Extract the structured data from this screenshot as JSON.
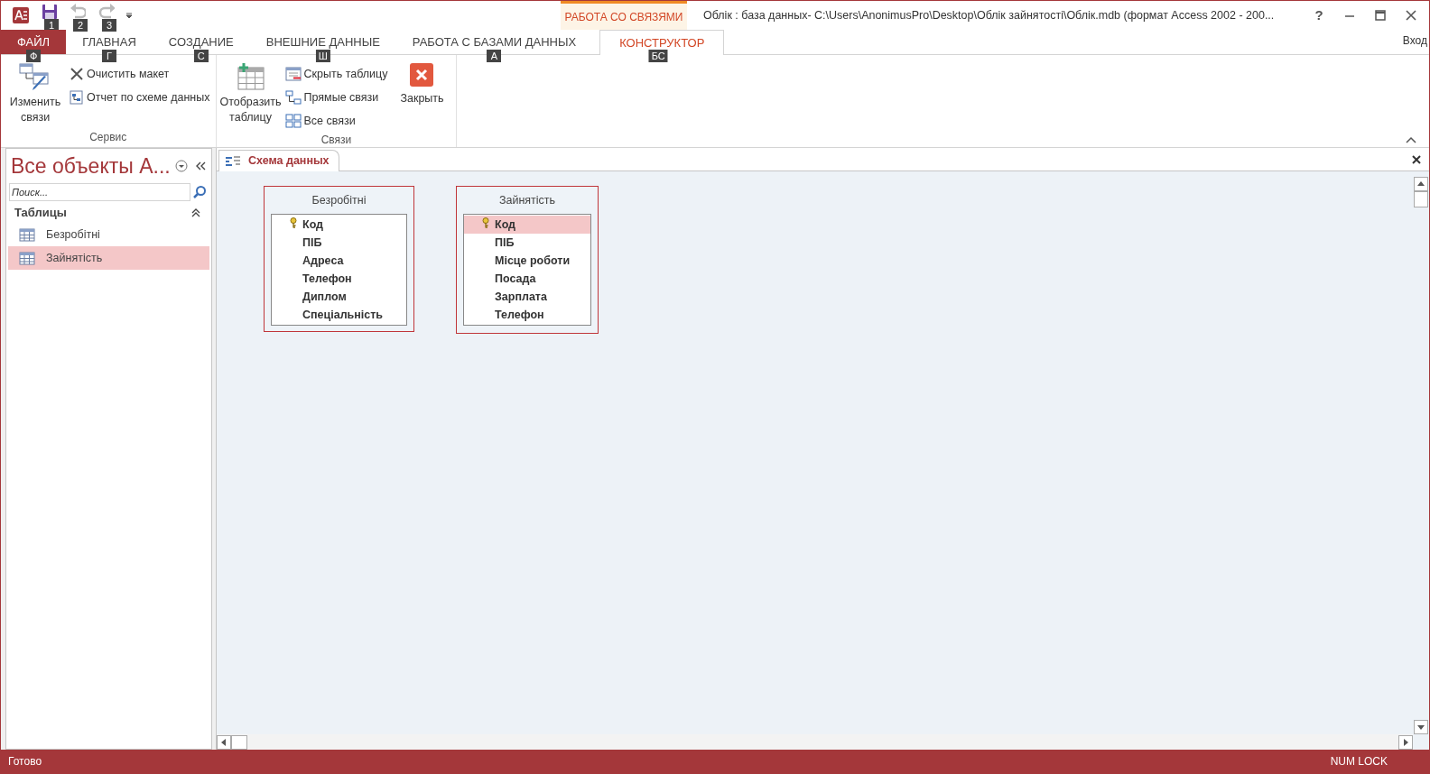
{
  "quick_access": [
    {
      "kind": "save",
      "keytip": "1",
      "disabled": false
    },
    {
      "kind": "undo",
      "keytip": "2",
      "disabled": true
    },
    {
      "kind": "redo",
      "keytip": "3",
      "disabled": true
    }
  ],
  "context_group": {
    "label": "РАБОТА СО СВЯЗЯМИ"
  },
  "window": {
    "title": "Облік : база данных- C:\\Users\\AnonimusPro\\Desktop\\Облік зайнятості\\Облік.mdb (формат Access 2002 - 200...",
    "help": "?",
    "sign_in": "Вход"
  },
  "ribbon_tabs": [
    {
      "label": "ФАЙЛ",
      "keytip": "Ф",
      "kind": "file",
      "selected": false
    },
    {
      "label": "ГЛАВНАЯ",
      "keytip": "Г",
      "kind": "normal",
      "selected": false
    },
    {
      "label": "СОЗДАНИЕ",
      "keytip": "С",
      "kind": "normal",
      "selected": false
    },
    {
      "label": "ВНЕШНИЕ ДАННЫЕ",
      "keytip": "Ш",
      "kind": "normal",
      "selected": false
    },
    {
      "label": "РАБОТА С БАЗАМИ ДАННЫХ",
      "keytip": "А",
      "kind": "normal",
      "selected": false
    },
    {
      "label": "КОНСТРУКТОР",
      "keytip": "БС",
      "kind": "contextual",
      "selected": true
    }
  ],
  "ribbon_groups": [
    {
      "label": "Сервис",
      "columns": [
        [
          {
            "label": "Изменить связи",
            "kind": "large"
          }
        ],
        [
          {
            "label": "Очистить макет",
            "kind": "small"
          },
          {
            "label": "Отчет по схеме данных",
            "kind": "small"
          }
        ]
      ]
    },
    {
      "label": "Связи",
      "columns": [
        [
          {
            "label": "Отобразить таблицу",
            "kind": "large"
          }
        ],
        [
          {
            "label": "Скрыть таблицу",
            "kind": "small"
          },
          {
            "label": "Прямые связи",
            "kind": "small"
          },
          {
            "label": "Все связи",
            "kind": "small"
          }
        ],
        [
          {
            "label": "Закрыть",
            "kind": "large"
          }
        ]
      ]
    }
  ],
  "nav_pane": {
    "title": "Все объекты А...",
    "search": {
      "placeholder": "Поиск..."
    },
    "group": "Таблицы",
    "items": [
      {
        "label": "Безробітні",
        "selected": false
      },
      {
        "label": "Зайнятість",
        "selected": true
      }
    ]
  },
  "document_tab": {
    "label": "Схема данных"
  },
  "tables": [
    {
      "title": "Безробітні",
      "fields": [
        {
          "name": "Код",
          "primary_key": true,
          "selected": false
        },
        {
          "name": "ПІБ",
          "primary_key": false,
          "selected": false
        },
        {
          "name": "Адреса",
          "primary_key": false,
          "selected": false
        },
        {
          "name": "Телефон",
          "primary_key": false,
          "selected": false
        },
        {
          "name": "Диплом",
          "primary_key": false,
          "selected": false
        },
        {
          "name": "Спеціальність",
          "primary_key": false,
          "selected": false
        }
      ]
    },
    {
      "title": "Зайнятість",
      "fields": [
        {
          "name": "Код",
          "primary_key": true,
          "selected": true
        },
        {
          "name": "ПІБ",
          "primary_key": false,
          "selected": false
        },
        {
          "name": "Місце роботи",
          "primary_key": false,
          "selected": false
        },
        {
          "name": "Посада",
          "primary_key": false,
          "selected": false
        },
        {
          "name": "Зарплата",
          "primary_key": false,
          "selected": false
        },
        {
          "name": "Телефон",
          "primary_key": false,
          "selected": false
        }
      ]
    }
  ],
  "status_bar": {
    "left": "Готово",
    "right": "NUM LOCK"
  }
}
